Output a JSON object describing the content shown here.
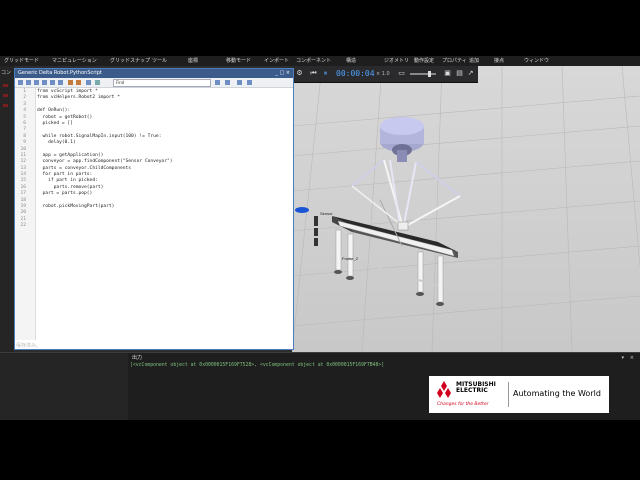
{
  "menu": [
    "グリッドモード",
    "マニピュレーション",
    "グリッドスナップ",
    "ツール",
    "座標",
    "移動モード",
    "インポート",
    "コンポーネント",
    "構造",
    "ジオメトリ",
    "動作設定",
    "プロパティ",
    "追加",
    "接点",
    "ウィンドウ"
  ],
  "left_panel": {
    "label": "コン"
  },
  "script_editor": {
    "title": "Generic Delta Robot.PythonScript",
    "window_buttons": "_ □ ×",
    "find_placeholder": "Find",
    "lines": [
      {
        "n": "1",
        "text": "from vcScript import *"
      },
      {
        "n": "2",
        "text": "from vcHelpers.Robot2 import *"
      },
      {
        "n": "3",
        "text": ""
      },
      {
        "n": "4",
        "text": "def OnRun():"
      },
      {
        "n": "5",
        "text": "  robot = getRobot()"
      },
      {
        "n": "6",
        "text": "  picked = []"
      },
      {
        "n": "7",
        "text": ""
      },
      {
        "n": "8",
        "text": "  while robot.SignalMapIn.input(100) != True:"
      },
      {
        "n": "9",
        "text": "    delay(0.1)"
      },
      {
        "n": "10",
        "text": ""
      },
      {
        "n": "11",
        "text": "  app = getApplication()"
      },
      {
        "n": "12",
        "text": "  conveyor = app.findComponent(\"Sensor Conveyor\")"
      },
      {
        "n": "13",
        "text": "  parts = conveyor.ChildComponents"
      },
      {
        "n": "14",
        "text": "  for part in parts:"
      },
      {
        "n": "15",
        "text": "    if part in picked:"
      },
      {
        "n": "16",
        "text": "      parts.remove(part)"
      },
      {
        "n": "17",
        "text": "  part = parts.pop()"
      },
      {
        "n": "18",
        "text": ""
      },
      {
        "n": "19",
        "text": "  robot.pickMovingPart(part)"
      },
      {
        "n": "20",
        "text": ""
      },
      {
        "n": "21",
        "text": ""
      },
      {
        "n": "22",
        "text": ""
      }
    ],
    "status": "保存済み。"
  },
  "viewport": {
    "time": "00:00:04",
    "speed": "× 1.0",
    "labels": {
      "frame": "Frame_2",
      "sensor": "Sensor",
      "belt": "Belt"
    }
  },
  "output": {
    "title": "出力",
    "pin": "▾",
    "close": "×",
    "line": "[<vcComponent object at 0x0000015F169F7528>, <vcComponent object at 0x0000015F169F7B48>]"
  },
  "logo": {
    "brand_line1": "MITSUBISHI",
    "brand_line2": "ELECTRIC",
    "tagline": "Changes for the Better",
    "slogan": "Automating the World"
  },
  "colors": {
    "accent_blue": "#4fa3ff",
    "brand_red": "#d2001c",
    "output_green": "#7ec27e"
  }
}
